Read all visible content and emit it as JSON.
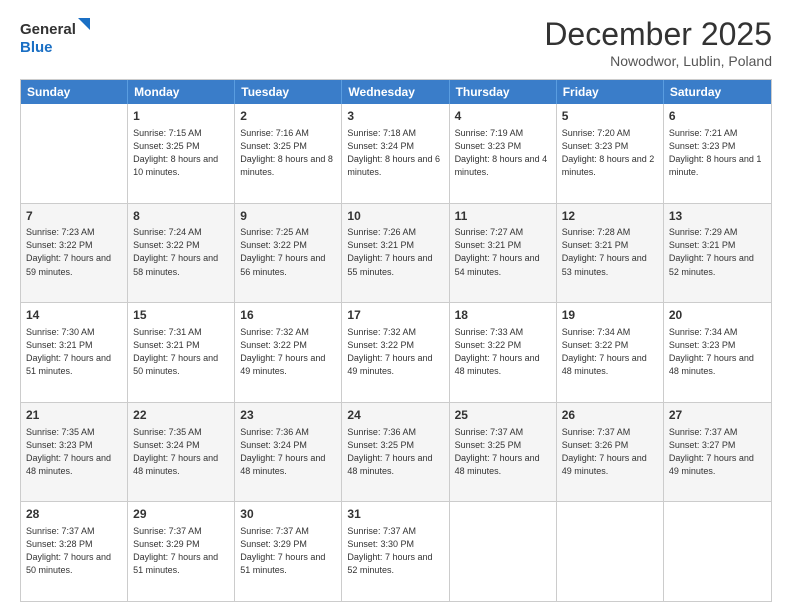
{
  "logo": {
    "line1": "General",
    "line2": "Blue"
  },
  "title": "December 2025",
  "location": "Nowodwor, Lublin, Poland",
  "weekdays": [
    "Sunday",
    "Monday",
    "Tuesday",
    "Wednesday",
    "Thursday",
    "Friday",
    "Saturday"
  ],
  "rows": [
    [
      {
        "day": "",
        "sunrise": "",
        "sunset": "",
        "daylight": ""
      },
      {
        "day": "1",
        "sunrise": "Sunrise: 7:15 AM",
        "sunset": "Sunset: 3:25 PM",
        "daylight": "Daylight: 8 hours and 10 minutes."
      },
      {
        "day": "2",
        "sunrise": "Sunrise: 7:16 AM",
        "sunset": "Sunset: 3:25 PM",
        "daylight": "Daylight: 8 hours and 8 minutes."
      },
      {
        "day": "3",
        "sunrise": "Sunrise: 7:18 AM",
        "sunset": "Sunset: 3:24 PM",
        "daylight": "Daylight: 8 hours and 6 minutes."
      },
      {
        "day": "4",
        "sunrise": "Sunrise: 7:19 AM",
        "sunset": "Sunset: 3:23 PM",
        "daylight": "Daylight: 8 hours and 4 minutes."
      },
      {
        "day": "5",
        "sunrise": "Sunrise: 7:20 AM",
        "sunset": "Sunset: 3:23 PM",
        "daylight": "Daylight: 8 hours and 2 minutes."
      },
      {
        "day": "6",
        "sunrise": "Sunrise: 7:21 AM",
        "sunset": "Sunset: 3:23 PM",
        "daylight": "Daylight: 8 hours and 1 minute."
      }
    ],
    [
      {
        "day": "7",
        "sunrise": "Sunrise: 7:23 AM",
        "sunset": "Sunset: 3:22 PM",
        "daylight": "Daylight: 7 hours and 59 minutes."
      },
      {
        "day": "8",
        "sunrise": "Sunrise: 7:24 AM",
        "sunset": "Sunset: 3:22 PM",
        "daylight": "Daylight: 7 hours and 58 minutes."
      },
      {
        "day": "9",
        "sunrise": "Sunrise: 7:25 AM",
        "sunset": "Sunset: 3:22 PM",
        "daylight": "Daylight: 7 hours and 56 minutes."
      },
      {
        "day": "10",
        "sunrise": "Sunrise: 7:26 AM",
        "sunset": "Sunset: 3:21 PM",
        "daylight": "Daylight: 7 hours and 55 minutes."
      },
      {
        "day": "11",
        "sunrise": "Sunrise: 7:27 AM",
        "sunset": "Sunset: 3:21 PM",
        "daylight": "Daylight: 7 hours and 54 minutes."
      },
      {
        "day": "12",
        "sunrise": "Sunrise: 7:28 AM",
        "sunset": "Sunset: 3:21 PM",
        "daylight": "Daylight: 7 hours and 53 minutes."
      },
      {
        "day": "13",
        "sunrise": "Sunrise: 7:29 AM",
        "sunset": "Sunset: 3:21 PM",
        "daylight": "Daylight: 7 hours and 52 minutes."
      }
    ],
    [
      {
        "day": "14",
        "sunrise": "Sunrise: 7:30 AM",
        "sunset": "Sunset: 3:21 PM",
        "daylight": "Daylight: 7 hours and 51 minutes."
      },
      {
        "day": "15",
        "sunrise": "Sunrise: 7:31 AM",
        "sunset": "Sunset: 3:21 PM",
        "daylight": "Daylight: 7 hours and 50 minutes."
      },
      {
        "day": "16",
        "sunrise": "Sunrise: 7:32 AM",
        "sunset": "Sunset: 3:22 PM",
        "daylight": "Daylight: 7 hours and 49 minutes."
      },
      {
        "day": "17",
        "sunrise": "Sunrise: 7:32 AM",
        "sunset": "Sunset: 3:22 PM",
        "daylight": "Daylight: 7 hours and 49 minutes."
      },
      {
        "day": "18",
        "sunrise": "Sunrise: 7:33 AM",
        "sunset": "Sunset: 3:22 PM",
        "daylight": "Daylight: 7 hours and 48 minutes."
      },
      {
        "day": "19",
        "sunrise": "Sunrise: 7:34 AM",
        "sunset": "Sunset: 3:22 PM",
        "daylight": "Daylight: 7 hours and 48 minutes."
      },
      {
        "day": "20",
        "sunrise": "Sunrise: 7:34 AM",
        "sunset": "Sunset: 3:23 PM",
        "daylight": "Daylight: 7 hours and 48 minutes."
      }
    ],
    [
      {
        "day": "21",
        "sunrise": "Sunrise: 7:35 AM",
        "sunset": "Sunset: 3:23 PM",
        "daylight": "Daylight: 7 hours and 48 minutes."
      },
      {
        "day": "22",
        "sunrise": "Sunrise: 7:35 AM",
        "sunset": "Sunset: 3:24 PM",
        "daylight": "Daylight: 7 hours and 48 minutes."
      },
      {
        "day": "23",
        "sunrise": "Sunrise: 7:36 AM",
        "sunset": "Sunset: 3:24 PM",
        "daylight": "Daylight: 7 hours and 48 minutes."
      },
      {
        "day": "24",
        "sunrise": "Sunrise: 7:36 AM",
        "sunset": "Sunset: 3:25 PM",
        "daylight": "Daylight: 7 hours and 48 minutes."
      },
      {
        "day": "25",
        "sunrise": "Sunrise: 7:37 AM",
        "sunset": "Sunset: 3:25 PM",
        "daylight": "Daylight: 7 hours and 48 minutes."
      },
      {
        "day": "26",
        "sunrise": "Sunrise: 7:37 AM",
        "sunset": "Sunset: 3:26 PM",
        "daylight": "Daylight: 7 hours and 49 minutes."
      },
      {
        "day": "27",
        "sunrise": "Sunrise: 7:37 AM",
        "sunset": "Sunset: 3:27 PM",
        "daylight": "Daylight: 7 hours and 49 minutes."
      }
    ],
    [
      {
        "day": "28",
        "sunrise": "Sunrise: 7:37 AM",
        "sunset": "Sunset: 3:28 PM",
        "daylight": "Daylight: 7 hours and 50 minutes."
      },
      {
        "day": "29",
        "sunrise": "Sunrise: 7:37 AM",
        "sunset": "Sunset: 3:29 PM",
        "daylight": "Daylight: 7 hours and 51 minutes."
      },
      {
        "day": "30",
        "sunrise": "Sunrise: 7:37 AM",
        "sunset": "Sunset: 3:29 PM",
        "daylight": "Daylight: 7 hours and 51 minutes."
      },
      {
        "day": "31",
        "sunrise": "Sunrise: 7:37 AM",
        "sunset": "Sunset: 3:30 PM",
        "daylight": "Daylight: 7 hours and 52 minutes."
      },
      {
        "day": "",
        "sunrise": "",
        "sunset": "",
        "daylight": ""
      },
      {
        "day": "",
        "sunrise": "",
        "sunset": "",
        "daylight": ""
      },
      {
        "day": "",
        "sunrise": "",
        "sunset": "",
        "daylight": ""
      }
    ]
  ]
}
